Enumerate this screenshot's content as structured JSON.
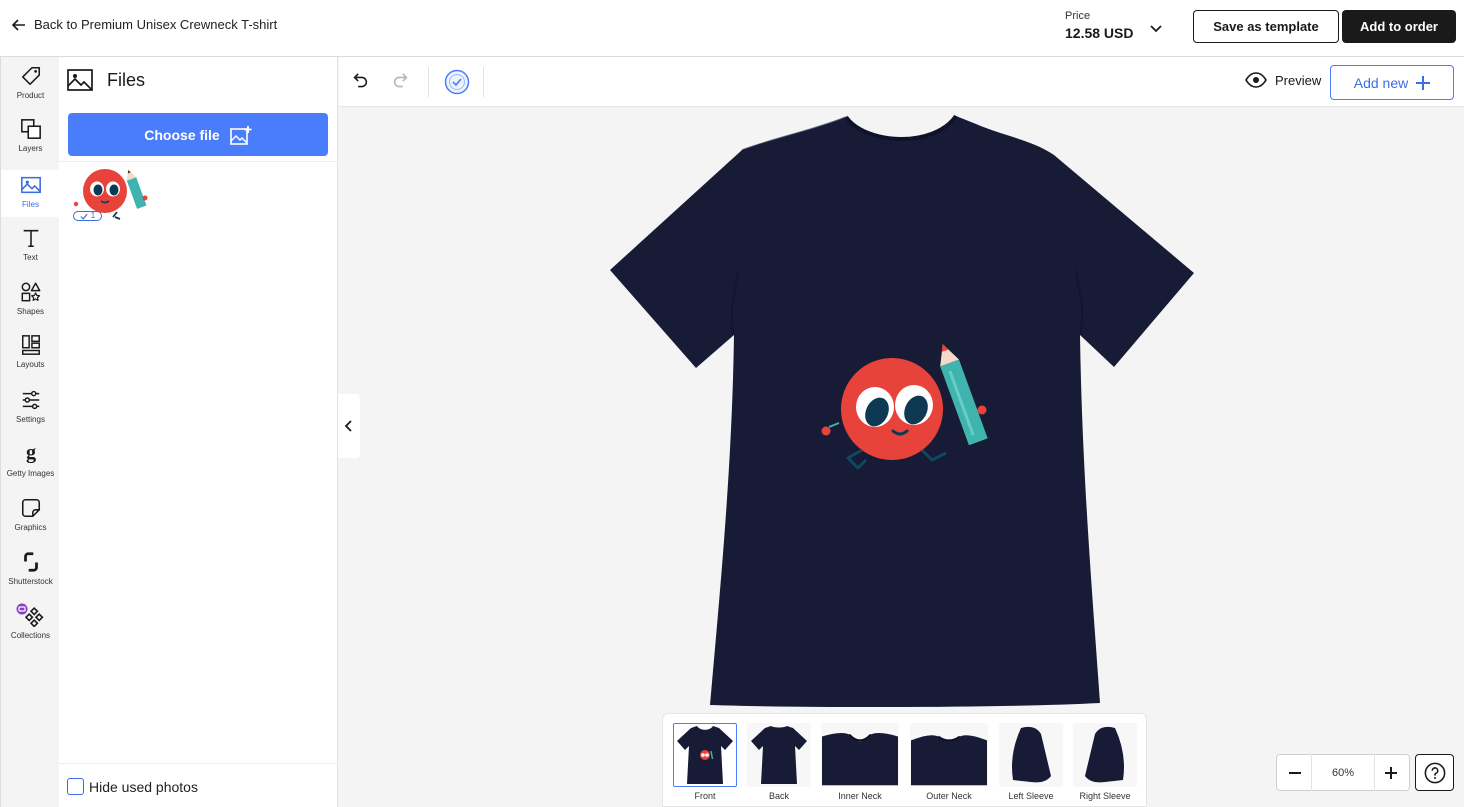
{
  "header": {
    "back_label": "Back to Premium Unisex Crewneck T-shirt",
    "price_label": "Price",
    "price_value": "12.58 USD",
    "save_template_label": "Save as template",
    "add_to_order_label": "Add to order"
  },
  "sidebar": {
    "items": [
      {
        "label": "Product",
        "icon": "tag-icon"
      },
      {
        "label": "Layers",
        "icon": "layers-icon"
      },
      {
        "label": "Files",
        "icon": "image-icon",
        "active": true
      },
      {
        "label": "Text",
        "icon": "text-icon"
      },
      {
        "label": "Shapes",
        "icon": "shapes-icon"
      },
      {
        "label": "Layouts",
        "icon": "layouts-icon"
      },
      {
        "label": "Settings",
        "icon": "sliders-icon"
      },
      {
        "label": "Getty Images",
        "icon": "getty-g-icon"
      },
      {
        "label": "Graphics",
        "icon": "sticker-icon"
      },
      {
        "label": "Shutterstock",
        "icon": "shutterstock-icon"
      },
      {
        "label": "Collections",
        "icon": "collections-icon"
      }
    ]
  },
  "files_panel": {
    "title": "Files",
    "choose_file_label": "Choose file",
    "used_count": "1",
    "hide_used_label": "Hide used photos",
    "hide_used_checked": false
  },
  "toolbar": {
    "preview_label": "Preview",
    "add_new_label": "Add new"
  },
  "product": {
    "shirt_color": "#171b36",
    "design_colors": {
      "circle": "#e8433a",
      "pencil": "#3fb3ad",
      "eyes": "#0d3a52"
    }
  },
  "views": {
    "items": [
      {
        "label": "Front",
        "active": true
      },
      {
        "label": "Back"
      },
      {
        "label": "Inner Neck"
      },
      {
        "label": "Outer Neck"
      },
      {
        "label": "Left Sleeve"
      },
      {
        "label": "Right Sleeve"
      }
    ]
  },
  "zoom": {
    "value": "60%"
  },
  "colors": {
    "accent": "#4a7dfc",
    "dark": "#1a1a1a"
  }
}
